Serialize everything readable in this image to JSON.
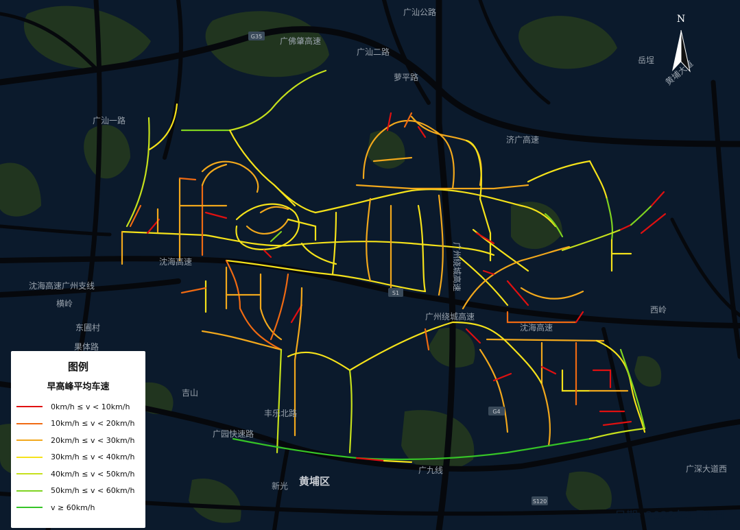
{
  "map": {
    "colors": {
      "background": "#0b1a2c",
      "major_road": "#06080c",
      "green_area": "#21351f",
      "v0_10": "#e01010",
      "v10_20": "#f06a12",
      "v20_30": "#f2a81c",
      "v30_40": "#f5e21a",
      "v40_50": "#c6e01c",
      "v50_60": "#7fd320",
      "v60": "#36c427"
    },
    "labels": [
      {
        "id": "guangshan-gonglu",
        "text": "广汕公路"
      },
      {
        "id": "guangfozhao",
        "text": "广佛肇高速"
      },
      {
        "id": "guangshan-erlu",
        "text": "广汕二路"
      },
      {
        "id": "luoping",
        "text": "萝平路"
      },
      {
        "id": "guangshan-yilu",
        "text": "广汕一路"
      },
      {
        "id": "jiguang",
        "text": "济广高速"
      },
      {
        "id": "yuehuang",
        "text": "岳埕"
      },
      {
        "id": "guangzhou-huancheng",
        "text": "广州绕城高速"
      },
      {
        "id": "shenhai-lbl",
        "text": "沈海高速"
      },
      {
        "id": "shenhai-gz",
        "text": "沈海高速广州支线"
      },
      {
        "id": "dongtian",
        "text": "东圃村"
      },
      {
        "id": "guangzhou-huancheng2",
        "text": "广州绕城高速"
      },
      {
        "id": "shenhai-lbl2",
        "text": "沈海高速"
      },
      {
        "id": "xiling",
        "text": "西岭"
      },
      {
        "id": "guoti",
        "text": "果体路"
      },
      {
        "id": "jishan",
        "text": "吉山"
      },
      {
        "id": "fengle",
        "text": "丰乐北路"
      },
      {
        "id": "guangyuan",
        "text": "广园快速路"
      },
      {
        "id": "huangpu",
        "text": "黄埔区"
      },
      {
        "id": "xinguang",
        "text": "新光"
      },
      {
        "id": "guangjiu",
        "text": "广九线"
      },
      {
        "id": "guangshen",
        "text": "广深大道西"
      },
      {
        "id": "huangcun",
        "text": "横岭"
      },
      {
        "id": "huangpu-ave",
        "text": "黄埔大道"
      }
    ],
    "shields": [
      {
        "id": "g35",
        "text": "G35"
      },
      {
        "id": "s1",
        "text": "S1"
      },
      {
        "id": "s120",
        "text": "S120"
      },
      {
        "id": "g4",
        "text": "G4"
      }
    ]
  },
  "north_arrow": {
    "letter": "N"
  },
  "legend": {
    "title": "图例",
    "subtitle": "早高峰平均车速",
    "items": [
      {
        "label": "0km/h ≤ v < 10km/h",
        "color": "#e01010"
      },
      {
        "label": "10km/h ≤ v < 20km/h",
        "color": "#f06a12"
      },
      {
        "label": "20km/h ≤ v < 30km/h",
        "color": "#f2a81c"
      },
      {
        "label": "30km/h ≤ v < 40km/h",
        "color": "#f5e21a"
      },
      {
        "label": "40km/h ≤ v < 50km/h",
        "color": "#c6e01c"
      },
      {
        "label": "50km/h ≤ v < 60km/h",
        "color": "#7fd320"
      },
      {
        "label": "v ≥ 60km/h",
        "color": "#36c427"
      }
    ]
  },
  "date_stamp": "日期: 2022年1月1日"
}
